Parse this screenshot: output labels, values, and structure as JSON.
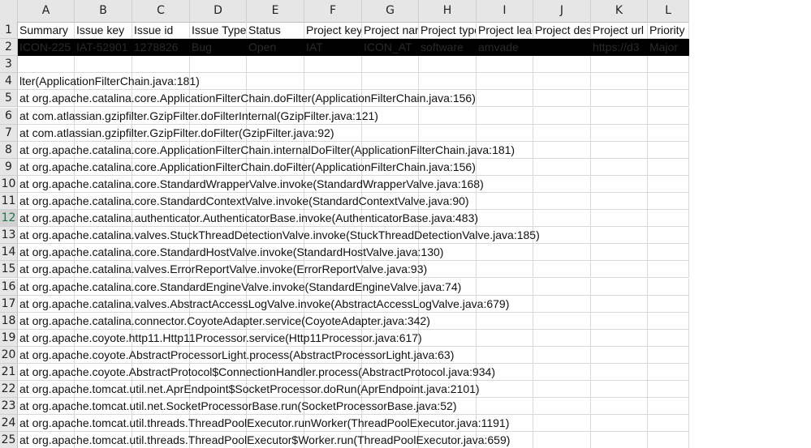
{
  "columns": [
    "A",
    "B",
    "C",
    "D",
    "E",
    "F",
    "G",
    "H",
    "I",
    "J",
    "K",
    "L"
  ],
  "row_numbers": [
    "1",
    "2",
    "3",
    "4",
    "5",
    "6",
    "7",
    "8",
    "9",
    "10",
    "11",
    "12",
    "13",
    "14",
    "15",
    "16",
    "17",
    "18",
    "19",
    "20",
    "21",
    "22",
    "23",
    "24",
    "25"
  ],
  "header_row": [
    "Summary",
    "Issue key",
    "Issue id",
    "Issue Type",
    "Status",
    "Project key",
    "Project name",
    "Project type",
    "Project lead",
    "Project description",
    "Project url",
    "Priority"
  ],
  "data_row": [
    "ICON-225",
    "IAT-52901",
    "1278826",
    "Bug",
    "Open",
    "IAT",
    "ICON_AT",
    "software",
    "amvade",
    "",
    "https://d3",
    "Major"
  ],
  "stack_lines": [
    "lter(ApplicationFilterChain.java:181)",
    "at org.apache.catalina.core.ApplicationFilterChain.doFilter(ApplicationFilterChain.java:156)",
    "at com.atlassian.gzipfilter.GzipFilter.doFilterInternal(GzipFilter.java:121)",
    "at com.atlassian.gzipfilter.GzipFilter.doFilter(GzipFilter.java:92)",
    "at org.apache.catalina.core.ApplicationFilterChain.internalDoFilter(ApplicationFilterChain.java:181)",
    "at org.apache.catalina.core.ApplicationFilterChain.doFilter(ApplicationFilterChain.java:156)",
    "at org.apache.catalina.core.StandardWrapperValve.invoke(StandardWrapperValve.java:168)",
    "at org.apache.catalina.core.StandardContextValve.invoke(StandardContextValve.java:90)",
    "at org.apache.catalina.authenticator.AuthenticatorBase.invoke(AuthenticatorBase.java:483)",
    "at org.apache.catalina.valves.StuckThreadDetectionValve.invoke(StuckThreadDetectionValve.java:185)",
    "at org.apache.catalina.core.StandardHostValve.invoke(StandardHostValve.java:130)",
    "at org.apache.catalina.valves.ErrorReportValve.invoke(ErrorReportValve.java:93)",
    "at org.apache.catalina.core.StandardEngineValve.invoke(StandardEngineValve.java:74)",
    "at org.apache.catalina.valves.AbstractAccessLogValve.invoke(AbstractAccessLogValve.java:679)",
    "at org.apache.catalina.connector.CoyoteAdapter.service(CoyoteAdapter.java:342)",
    "at org.apache.coyote.http11.Http11Processor.service(Http11Processor.java:617)",
    "at org.apache.coyote.AbstractProcessorLight.process(AbstractProcessorLight.java:63)",
    "at org.apache.coyote.AbstractProtocol$ConnectionHandler.process(AbstractProtocol.java:934)",
    "at org.apache.tomcat.util.net.AprEndpoint$SocketProcessor.doRun(AprEndpoint.java:2101)",
    "at org.apache.tomcat.util.net.SocketProcessorBase.run(SocketProcessorBase.java:52)",
    "at org.apache.tomcat.util.threads.ThreadPoolExecutor.runWorker(ThreadPoolExecutor.java:1191)",
    "at org.apache.tomcat.util.threads.ThreadPoolExecutor$Worker.run(ThreadPoolExecutor.java:659)"
  ],
  "colors": {
    "header_bg": "#e6e6e6",
    "redacted_row_bg": "#000000",
    "grid": "#d9d9d9"
  }
}
